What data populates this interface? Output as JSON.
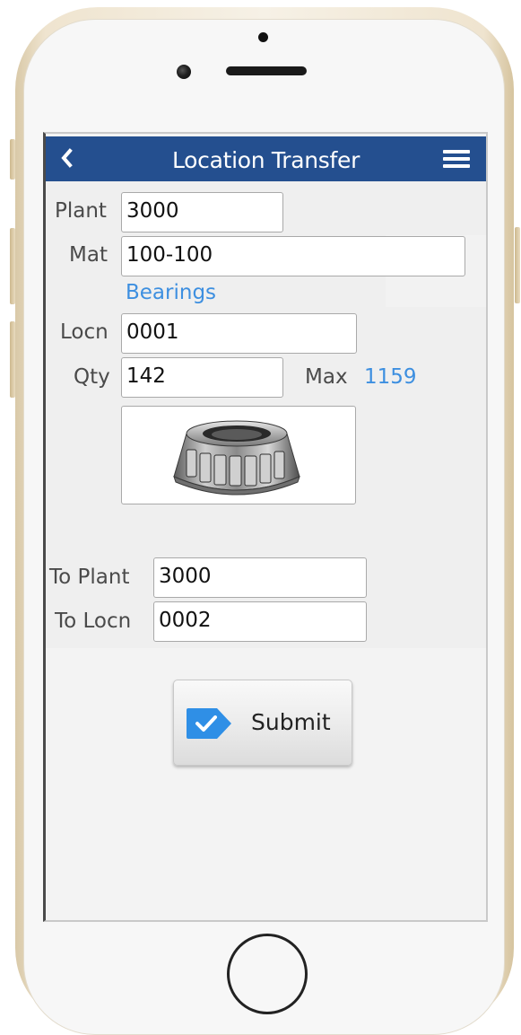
{
  "header": {
    "title": "Location Transfer",
    "back_icon": "chevron-left-icon",
    "menu_icon": "hamburger-menu-icon",
    "color": "#244f8f"
  },
  "form": {
    "plant": {
      "label": "Plant",
      "value": "3000"
    },
    "material": {
      "label": "Mat",
      "value": "100-100",
      "description": "Bearings"
    },
    "location": {
      "label": "Locn",
      "value": "0001"
    },
    "quantity": {
      "label": "Qty",
      "value": "142",
      "max_label": "Max",
      "max_value": "1159"
    },
    "to_plant": {
      "label": "To Plant",
      "value": "3000"
    },
    "to_location": {
      "label": "To Locn",
      "value": "0002"
    }
  },
  "submit": {
    "label": "Submit",
    "icon": "checkmark-tag-icon",
    "icon_color": "#2f8fe6"
  },
  "colors": {
    "accent_text": "#3d8fe0"
  }
}
